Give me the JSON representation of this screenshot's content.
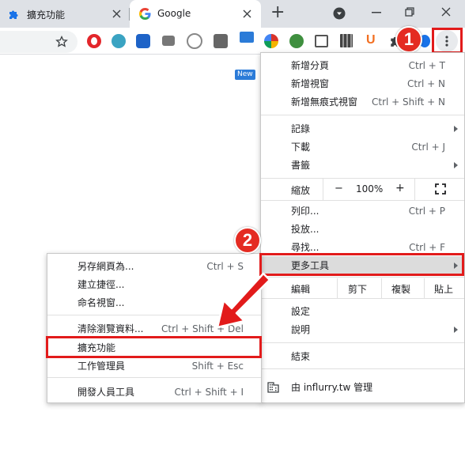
{
  "tabs": [
    {
      "title": "擴充功能",
      "icon": "puzzle-icon"
    },
    {
      "title": "Google",
      "icon": "google-g-icon"
    }
  ],
  "new_tab_symbol": "+",
  "extensions": [
    {
      "name": "opera-red-icon",
      "color": "#e3262b"
    },
    {
      "name": "teal-search-icon",
      "color": "#3aa3c2"
    },
    {
      "name": "blue-store-icon",
      "color": "#1e63c7"
    },
    {
      "name": "camera-icon",
      "color": "#777777"
    },
    {
      "name": "headset-icon",
      "color": "#888888"
    },
    {
      "name": "photo-icon",
      "color": "#555555"
    },
    {
      "name": "new-badge-icon",
      "color": "#2b7bd8"
    },
    {
      "name": "colorwheel-icon",
      "color": "#d9342b"
    },
    {
      "name": "globe-icon",
      "color": "#3f8f3f"
    },
    {
      "name": "window-icon",
      "color": "#555555"
    },
    {
      "name": "book-icon",
      "color": "#444444"
    },
    {
      "name": "u-icon",
      "color": "#f26f21"
    }
  ],
  "new_badge_text": "New",
  "main_menu": {
    "group1": [
      {
        "label": "新增分頁",
        "shortcut": "Ctrl + T"
      },
      {
        "label": "新增視窗",
        "shortcut": "Ctrl + N"
      },
      {
        "label": "新增無痕式視窗",
        "shortcut": "Ctrl + Shift + N"
      }
    ],
    "group2": [
      {
        "label": "記錄",
        "shortcut": ""
      },
      {
        "label": "下載",
        "shortcut": "Ctrl + J"
      },
      {
        "label": "書籤",
        "shortcut": ""
      }
    ],
    "zoom": {
      "label": "縮放",
      "minus": "−",
      "value": "100%",
      "plus": "+"
    },
    "group3": [
      {
        "label": "列印...",
        "shortcut": "Ctrl + P"
      },
      {
        "label": "投放...",
        "shortcut": ""
      },
      {
        "label": "尋找...",
        "shortcut": "Ctrl + F"
      },
      {
        "label": "更多工具",
        "shortcut": ""
      }
    ],
    "edit": {
      "label": "編輯",
      "cut": "剪下",
      "copy": "複製",
      "paste": "貼上"
    },
    "group4": [
      {
        "label": "設定",
        "shortcut": ""
      },
      {
        "label": "說明",
        "shortcut": ""
      }
    ],
    "exit": "結束",
    "managed": "由 influrry.tw 管理"
  },
  "sub_menu": {
    "group1": [
      {
        "label": "另存網頁為...",
        "shortcut": "Ctrl + S"
      },
      {
        "label": "建立捷徑...",
        "shortcut": ""
      },
      {
        "label": "命名視窗...",
        "shortcut": ""
      }
    ],
    "group2": [
      {
        "label": "清除瀏覽資料...",
        "shortcut": "Ctrl + Shift + Del"
      },
      {
        "label": "擴充功能",
        "shortcut": ""
      },
      {
        "label": "工作管理員",
        "shortcut": "Shift + Esc"
      }
    ],
    "group3": [
      {
        "label": "開發人員工具",
        "shortcut": "Ctrl + Shift + I"
      }
    ]
  },
  "annotations": {
    "step1": "1",
    "step2": "2",
    "highlight_color": "#e21b1b"
  }
}
